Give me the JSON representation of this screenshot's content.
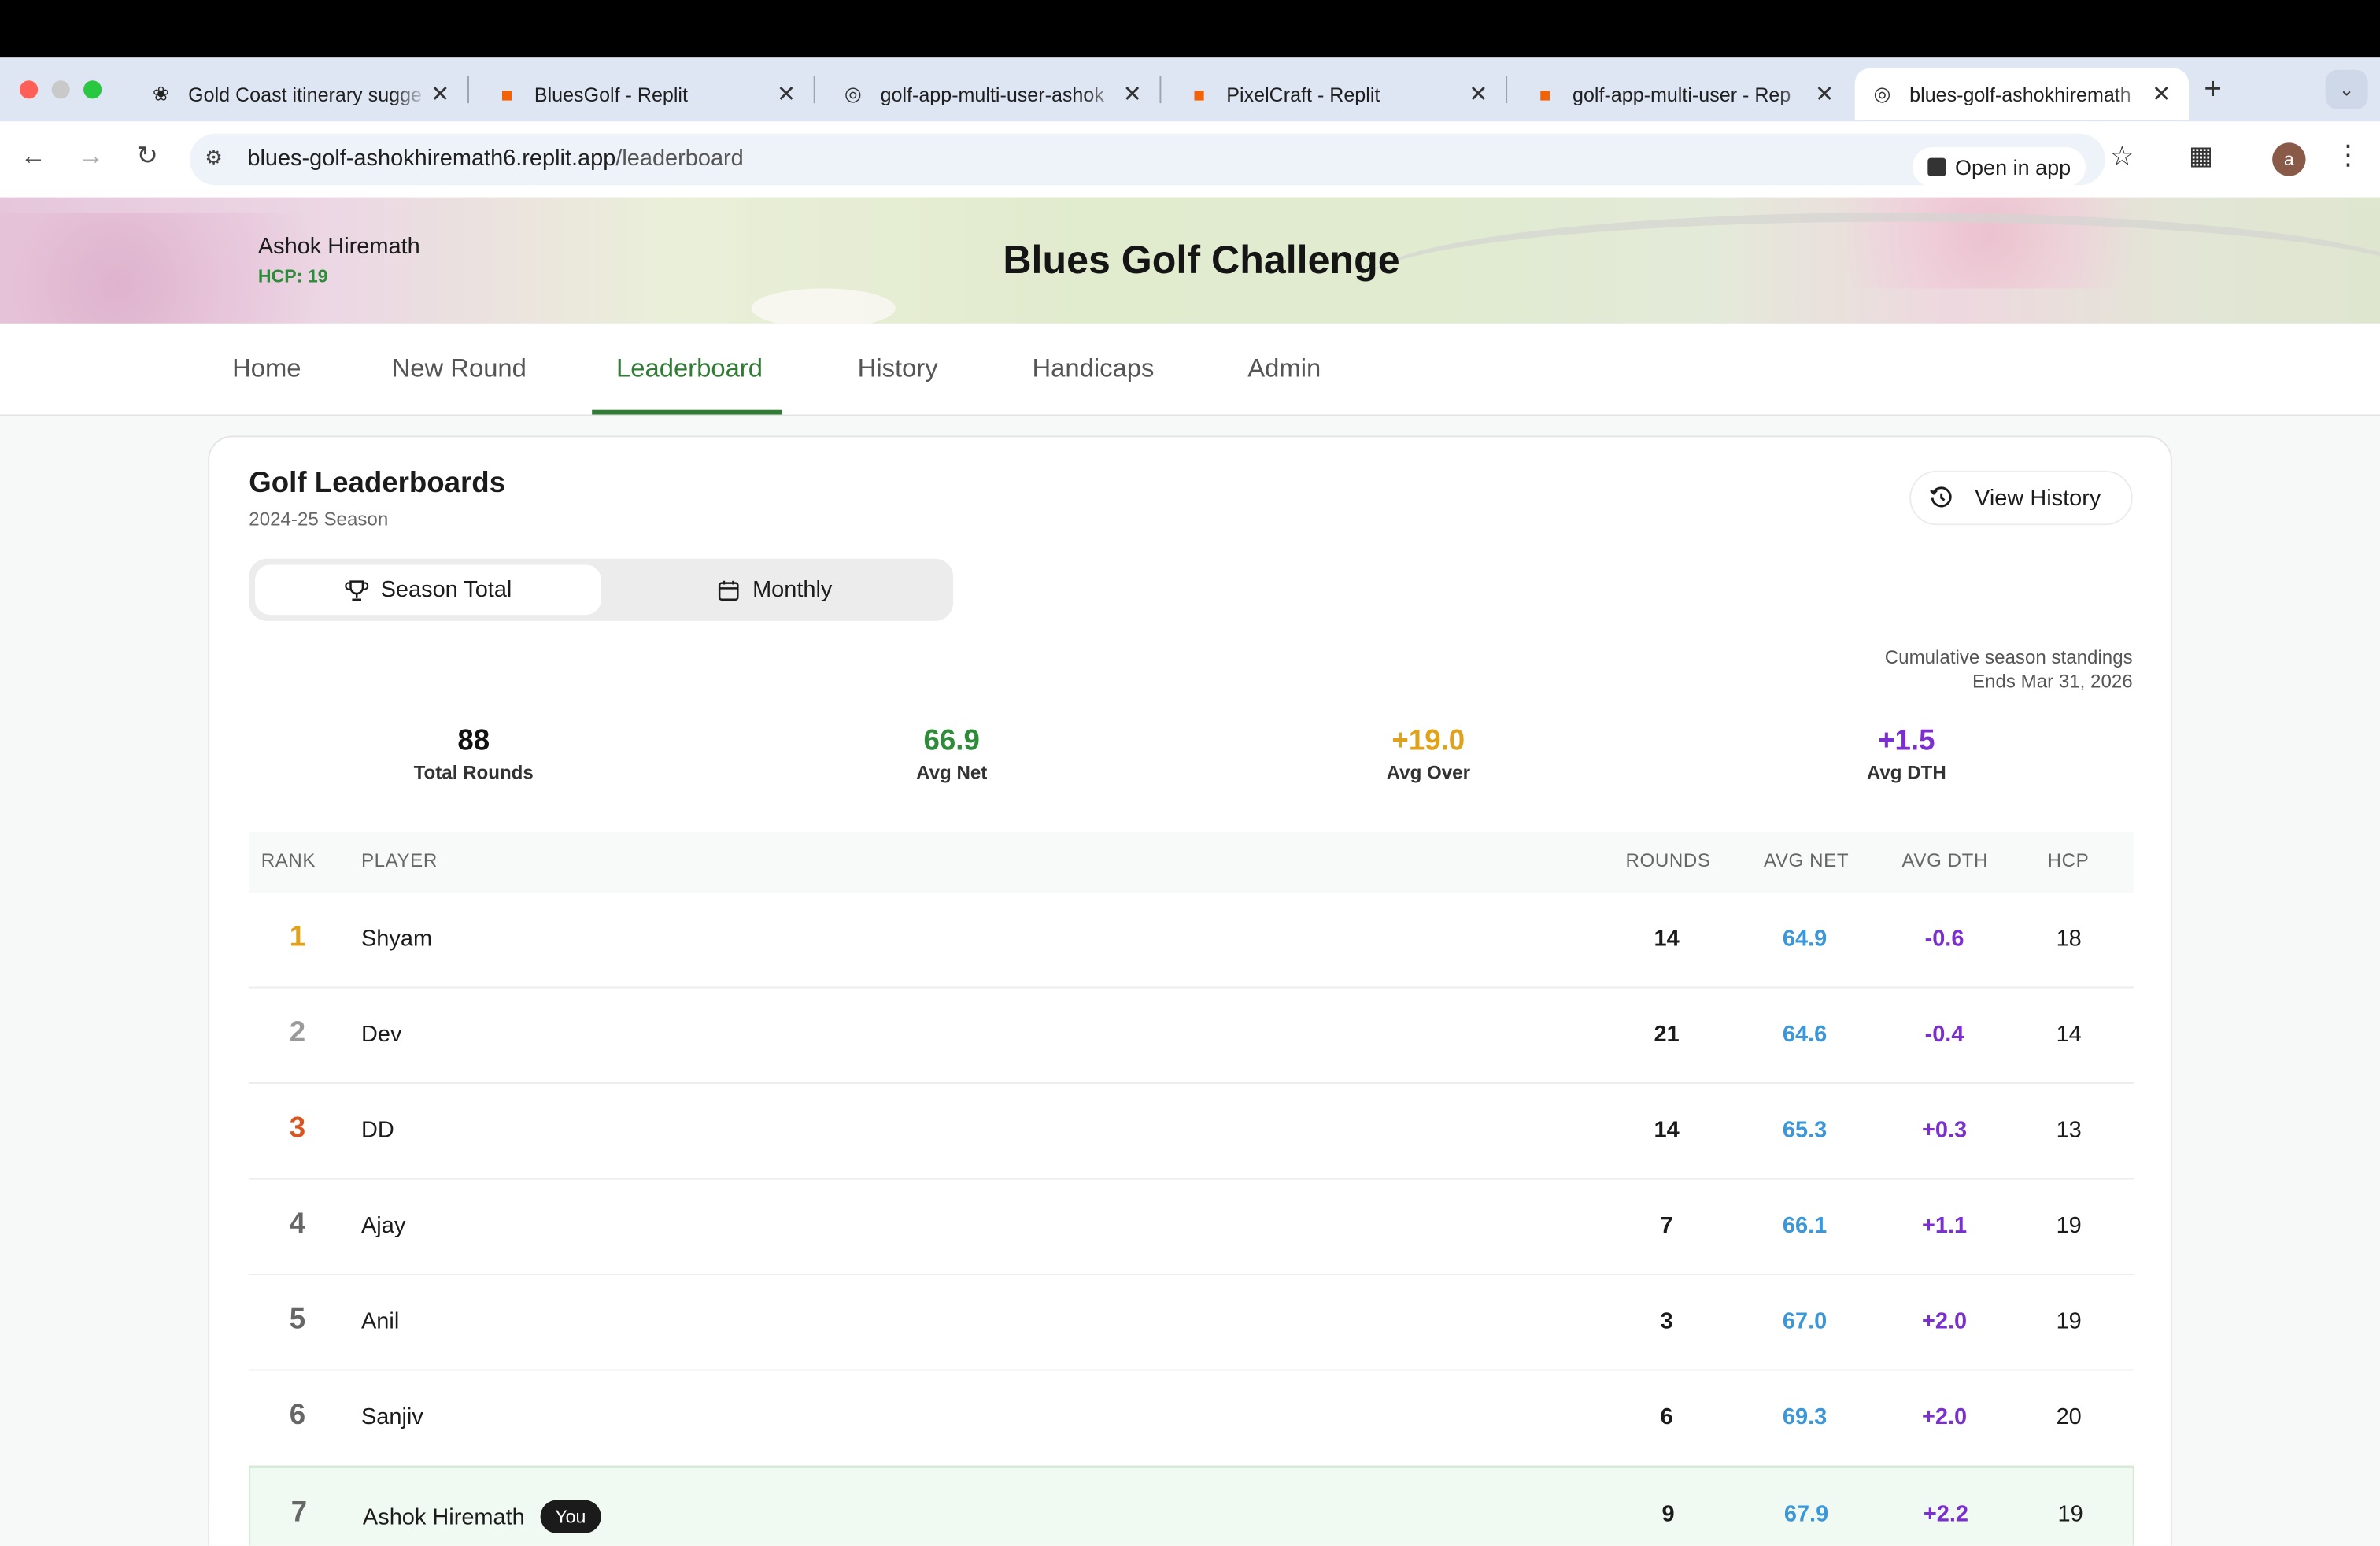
{
  "browser": {
    "tabs": [
      {
        "label": "Gold Coast itinerary sugge",
        "icon": "openai-icon"
      },
      {
        "label": "BluesGolf - Replit",
        "icon": "replit-icon"
      },
      {
        "label": "golf-app-multi-user-ashok",
        "icon": "globe-icon"
      },
      {
        "label": "PixelCraft - Replit",
        "icon": "replit-icon"
      },
      {
        "label": "golf-app-multi-user - Rep",
        "icon": "replit-icon"
      },
      {
        "label": "blues-golf-ashokhiremath",
        "icon": "globe-icon"
      }
    ],
    "url_host": "blues-golf-ashokhiremath6.replit.app",
    "url_path": "/leaderboard",
    "open_in_app": "Open in app",
    "profile_initial": "a"
  },
  "header": {
    "user_name": "Ashok Hiremath",
    "user_hcp": "HCP: 19",
    "title": "Blues Golf Challenge"
  },
  "nav": {
    "items": [
      "Home",
      "New Round",
      "Leaderboard",
      "History",
      "Handicaps",
      "Admin"
    ],
    "active": "Leaderboard"
  },
  "leaderboard": {
    "title": "Golf Leaderboards",
    "season": "2024-25 Season",
    "view_history": "View History",
    "toggle": {
      "season_total": "Season Total",
      "monthly": "Monthly",
      "active": "Season Total"
    },
    "standings_label": "Cumulative season standings",
    "ends_label": "Ends Mar 31, 2026",
    "stats": [
      {
        "value": "88",
        "label": "Total Rounds",
        "color": "#111111"
      },
      {
        "value": "66.9",
        "label": "Avg Net",
        "color": "#2e8b3a"
      },
      {
        "value": "+19.0",
        "label": "Avg Over",
        "color": "#e0a21a"
      },
      {
        "value": "+1.5",
        "label": "Avg DTH",
        "color": "#7b2fd0"
      }
    ],
    "columns": [
      "RANK",
      "PLAYER",
      "ROUNDS",
      "AVG NET",
      "AVG DTH",
      "HCP"
    ],
    "rows": [
      {
        "rank": "1",
        "player": "Shyam",
        "rounds": "14",
        "avg_net": "64.9",
        "avg_dth": "-0.6",
        "hcp": "18",
        "rank_color": "#e0a21a"
      },
      {
        "rank": "2",
        "player": "Dev",
        "rounds": "21",
        "avg_net": "64.6",
        "avg_dth": "-0.4",
        "hcp": "14",
        "rank_color": "#9a9a9a"
      },
      {
        "rank": "3",
        "player": "DD",
        "rounds": "14",
        "avg_net": "65.3",
        "avg_dth": "+0.3",
        "hcp": "13",
        "rank_color": "#d9541e"
      },
      {
        "rank": "4",
        "player": "Ajay",
        "rounds": "7",
        "avg_net": "66.1",
        "avg_dth": "+1.1",
        "hcp": "19",
        "rank_color": "#666666"
      },
      {
        "rank": "5",
        "player": "Anil",
        "rounds": "3",
        "avg_net": "67.0",
        "avg_dth": "+2.0",
        "hcp": "19",
        "rank_color": "#666666"
      },
      {
        "rank": "6",
        "player": "Sanjiv",
        "rounds": "6",
        "avg_net": "69.3",
        "avg_dth": "+2.0",
        "hcp": "20",
        "rank_color": "#666666"
      },
      {
        "rank": "7",
        "player": "Ashok Hiremath",
        "rounds": "9",
        "avg_net": "67.9",
        "avg_dth": "+2.2",
        "hcp": "19",
        "rank_color": "#666666",
        "you": "You"
      }
    ]
  }
}
